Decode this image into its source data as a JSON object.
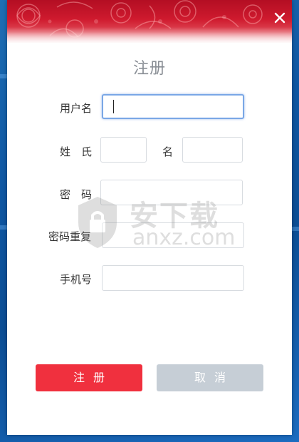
{
  "dialog": {
    "title": "注册",
    "close_icon": "close-icon"
  },
  "form": {
    "username_label": "用户名",
    "username_value": "",
    "surname_label": "姓　氏",
    "surname_value": "",
    "given_name_label": "名",
    "given_name_value": "",
    "password_label": "密　码",
    "password_value": "",
    "password_repeat_label": "密码重复",
    "password_repeat_value": "",
    "phone_label": "手机号",
    "phone_value": ""
  },
  "buttons": {
    "register_label": "注册",
    "cancel_label": "取消"
  },
  "watermark": {
    "cn_text": "安下载",
    "en_text": "anxz.com"
  },
  "colors": {
    "banner_red": "#cf1a2e",
    "primary_button": "#f0303e",
    "secondary_button": "#c6ced6",
    "focus_border": "#7aa7e6"
  }
}
